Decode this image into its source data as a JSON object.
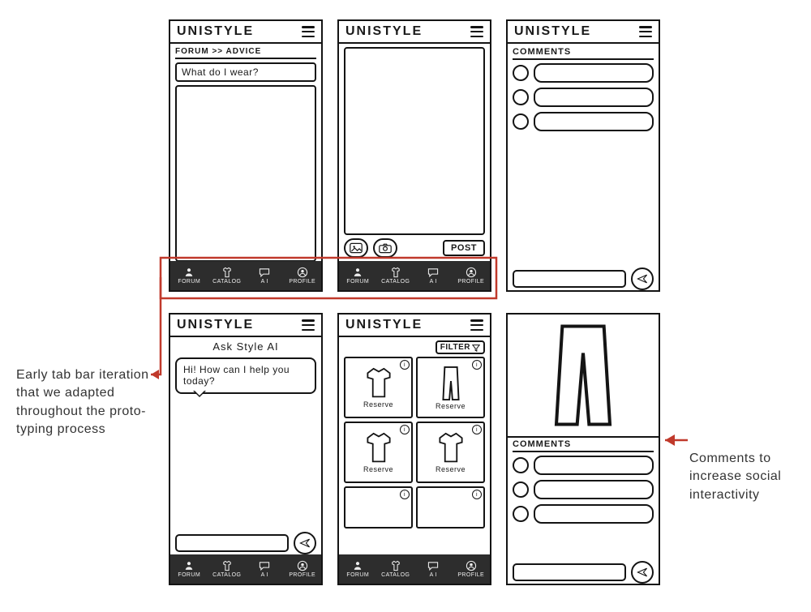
{
  "app": {
    "title": "UNISTYLE"
  },
  "tabs": {
    "forum": {
      "label": "FORUM"
    },
    "catalog": {
      "label": "CATALOG"
    },
    "ai": {
      "label": "A I"
    },
    "profile": {
      "label": "PROFILE"
    }
  },
  "screen1": {
    "breadcrumb": "FORUM >> ADVICE",
    "question": "What do I wear?"
  },
  "screen2": {
    "post_button": "POST"
  },
  "screen3": {
    "comments_label": "COMMENTS"
  },
  "screen4": {
    "subtitle": "Ask  Style AI",
    "bubble": "Hi! How can I help you today?"
  },
  "screen5": {
    "filter_label": "FILTER",
    "reserve_label": "Reserve"
  },
  "screen6": {
    "comments_label": "COMMENTS"
  },
  "annotations": {
    "left": "Early tab bar iteration that we adapted throughout the proto-typing process",
    "right": "Comments to increase social interactivity"
  }
}
